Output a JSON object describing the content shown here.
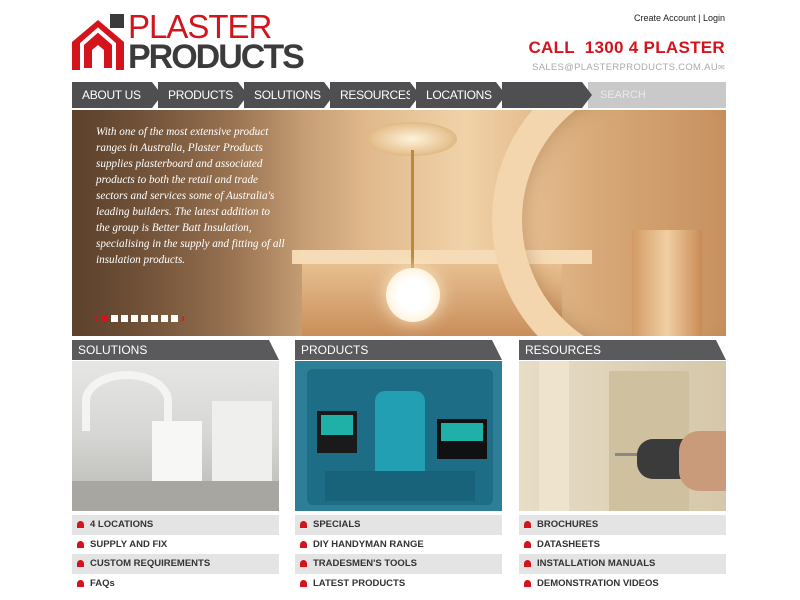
{
  "header": {
    "logo_line1": "PLASTER",
    "logo_line2": "PRODUCTS",
    "create_account": "Create Account",
    "separator": "|",
    "login": "Login",
    "call": "CALL  1300 4 PLASTER",
    "email": "SALES@PLASTERPRODUCTS.COM.AU",
    "email_icon": "✉"
  },
  "nav": {
    "items": [
      "ABOUT US",
      "PRODUCTS",
      "SOLUTIONS",
      "RESOURCES",
      "LOCATIONS"
    ],
    "search_placeholder": "SEARCH"
  },
  "hero": {
    "text": "With one of the most extensive product ranges in Australia, Plaster Products supplies plasterboard and associated products to both  the retail and trade sectors and services some of Australia's leading builders. The latest addition to the group is Better Batt Insulation, specialising in the supply and fitting of all insulation products.",
    "prev_arrow": "‹",
    "next_arrow": "›",
    "slide_count": 8,
    "active_slide": 1
  },
  "columns": [
    {
      "title": "SOLUTIONS",
      "items": [
        "4 LOCATIONS",
        "SUPPLY AND FIX",
        "CUSTOM REQUIREMENTS",
        "FAQs"
      ]
    },
    {
      "title": "PRODUCTS",
      "items": [
        "SPECIALS",
        "DIY HANDYMAN RANGE",
        "TRADESMEN'S TOOLS",
        "LATEST PRODUCTS"
      ]
    },
    {
      "title": "RESOURCES",
      "items": [
        "BROCHURES",
        "DATASHEETS",
        "INSTALLATION MANUALS",
        "DEMONSTRATION VIDEOS"
      ]
    }
  ],
  "colors": {
    "brand_red": "#d4141c",
    "nav_grey": "#4f4f51",
    "logo_dark": "#3b3b3b"
  }
}
